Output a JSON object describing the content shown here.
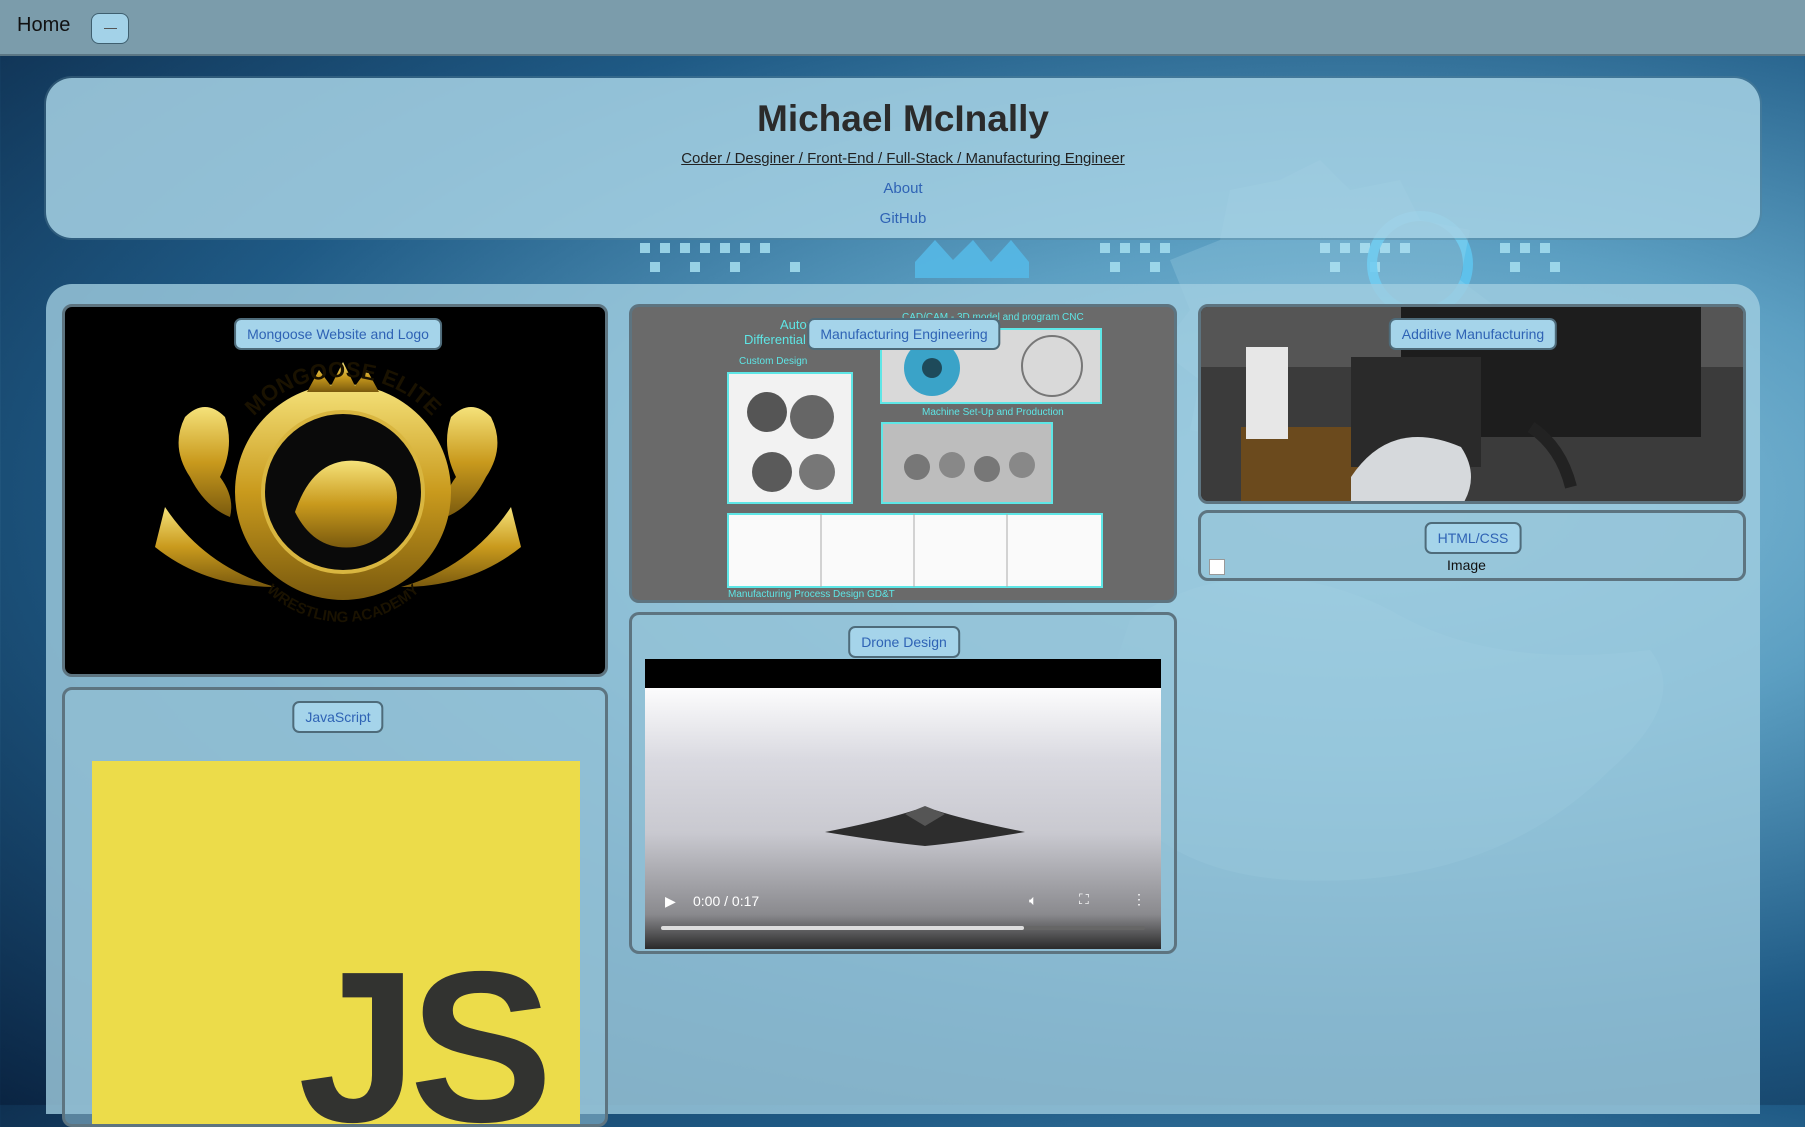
{
  "nav": {
    "home": "Home"
  },
  "header": {
    "title": "Michael McInally",
    "subtitle": "Coder / Desginer / Front-End / Full-Stack / Manufacturing Engineer",
    "links": [
      "About",
      "GitHub"
    ]
  },
  "cards": {
    "mongoose": {
      "label": "Mongoose Website and Logo",
      "logo_ring_top": "MONGOOSE ELITE",
      "logo_ring_bottom": "WRESTLING ACADEMY"
    },
    "manufacturing": {
      "label": "Manufacturing Engineering",
      "collage": {
        "heading_1": "Automatic Locking",
        "heading_2": "Differential",
        "cad": "CAD/CAM - 3D model and program CNC",
        "custom": "Custom Design",
        "machine": "Machine Set-Up and Production",
        "process": "Manufacturing Process Design GD&T"
      }
    },
    "additive": {
      "label": "Additive Manufacturing"
    },
    "htmlcss": {
      "label": "HTML/CSS",
      "image_alt": "Image"
    },
    "drone": {
      "label": "Drone Design",
      "video_time": "0:00 / 0:17",
      "progress": 0.75
    },
    "javascript": {
      "label": "JavaScript",
      "logo_text": "JS"
    }
  },
  "colors": {
    "link": "#2f63b5",
    "pill_bg": "#a5d4ea",
    "js_yellow": "#ecdc4a",
    "collage_cyan": "#5ee6e6"
  }
}
